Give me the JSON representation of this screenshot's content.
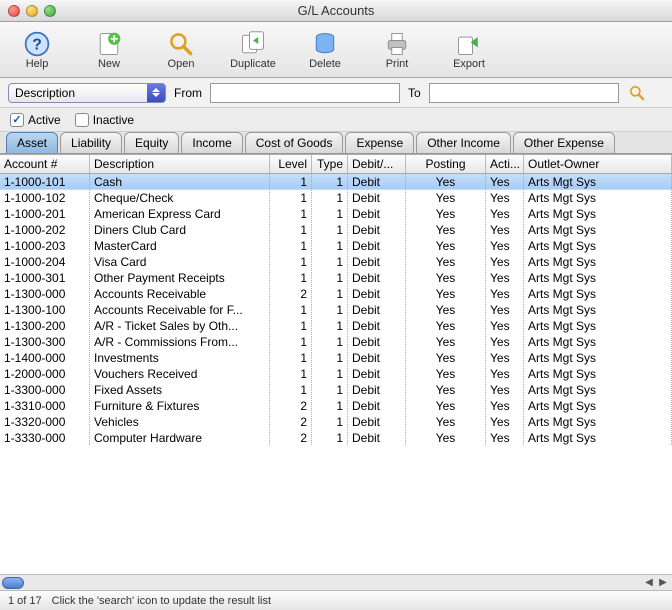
{
  "window": {
    "title": "G/L Accounts"
  },
  "toolbar": {
    "help": "Help",
    "new": "New",
    "open": "Open",
    "duplicate": "Duplicate",
    "delete": "Delete",
    "print": "Print",
    "export": "Export"
  },
  "search": {
    "field": "Description",
    "from_label": "From",
    "from_value": "",
    "to_label": "To",
    "to_value": ""
  },
  "filters": {
    "active_label": "Active",
    "active_checked": true,
    "inactive_label": "Inactive",
    "inactive_checked": false
  },
  "tabs": [
    {
      "label": "Asset",
      "active": true
    },
    {
      "label": "Liability",
      "active": false
    },
    {
      "label": "Equity",
      "active": false
    },
    {
      "label": "Income",
      "active": false
    },
    {
      "label": "Cost of Goods",
      "active": false
    },
    {
      "label": "Expense",
      "active": false
    },
    {
      "label": "Other Income",
      "active": false
    },
    {
      "label": "Other Expense",
      "active": false
    }
  ],
  "columns": [
    "Account #",
    "Description",
    "Level",
    "Type",
    "Debit/...",
    "Posting",
    "Acti...",
    "Outlet-Owner"
  ],
  "rows": [
    {
      "acct": "1-1000-101",
      "desc": "Cash",
      "level": "1",
      "type": "1",
      "dc": "Debit",
      "posting": "Yes",
      "active": "Yes",
      "owner": "Arts Mgt Sys",
      "selected": true
    },
    {
      "acct": "1-1000-102",
      "desc": "Cheque/Check",
      "level": "1",
      "type": "1",
      "dc": "Debit",
      "posting": "Yes",
      "active": "Yes",
      "owner": "Arts Mgt Sys"
    },
    {
      "acct": "1-1000-201",
      "desc": "American Express Card",
      "level": "1",
      "type": "1",
      "dc": "Debit",
      "posting": "Yes",
      "active": "Yes",
      "owner": "Arts Mgt Sys"
    },
    {
      "acct": "1-1000-202",
      "desc": "Diners Club Card",
      "level": "1",
      "type": "1",
      "dc": "Debit",
      "posting": "Yes",
      "active": "Yes",
      "owner": "Arts Mgt Sys"
    },
    {
      "acct": "1-1000-203",
      "desc": "MasterCard",
      "level": "1",
      "type": "1",
      "dc": "Debit",
      "posting": "Yes",
      "active": "Yes",
      "owner": "Arts Mgt Sys"
    },
    {
      "acct": "1-1000-204",
      "desc": "Visa Card",
      "level": "1",
      "type": "1",
      "dc": "Debit",
      "posting": "Yes",
      "active": "Yes",
      "owner": "Arts Mgt Sys"
    },
    {
      "acct": "1-1000-301",
      "desc": "Other Payment Receipts",
      "level": "1",
      "type": "1",
      "dc": "Debit",
      "posting": "Yes",
      "active": "Yes",
      "owner": "Arts Mgt Sys"
    },
    {
      "acct": "1-1300-000",
      "desc": "Accounts Receivable",
      "level": "2",
      "type": "1",
      "dc": "Debit",
      "posting": "Yes",
      "active": "Yes",
      "owner": "Arts Mgt Sys"
    },
    {
      "acct": "1-1300-100",
      "desc": "Accounts Receivable for F...",
      "level": "1",
      "type": "1",
      "dc": "Debit",
      "posting": "Yes",
      "active": "Yes",
      "owner": "Arts Mgt Sys"
    },
    {
      "acct": "1-1300-200",
      "desc": "A/R - Ticket Sales by Oth...",
      "level": "1",
      "type": "1",
      "dc": "Debit",
      "posting": "Yes",
      "active": "Yes",
      "owner": "Arts Mgt Sys"
    },
    {
      "acct": "1-1300-300",
      "desc": "A/R - Commissions From...",
      "level": "1",
      "type": "1",
      "dc": "Debit",
      "posting": "Yes",
      "active": "Yes",
      "owner": "Arts Mgt Sys"
    },
    {
      "acct": "1-1400-000",
      "desc": "Investments",
      "level": "1",
      "type": "1",
      "dc": "Debit",
      "posting": "Yes",
      "active": "Yes",
      "owner": "Arts Mgt Sys"
    },
    {
      "acct": "1-2000-000",
      "desc": "Vouchers Received",
      "level": "1",
      "type": "1",
      "dc": "Debit",
      "posting": "Yes",
      "active": "Yes",
      "owner": "Arts Mgt Sys"
    },
    {
      "acct": "1-3300-000",
      "desc": "Fixed Assets",
      "level": "1",
      "type": "1",
      "dc": "Debit",
      "posting": "Yes",
      "active": "Yes",
      "owner": "Arts Mgt Sys"
    },
    {
      "acct": "1-3310-000",
      "desc": "Furniture & Fixtures",
      "level": "2",
      "type": "1",
      "dc": "Debit",
      "posting": "Yes",
      "active": "Yes",
      "owner": "Arts Mgt Sys"
    },
    {
      "acct": "1-3320-000",
      "desc": "Vehicles",
      "level": "2",
      "type": "1",
      "dc": "Debit",
      "posting": "Yes",
      "active": "Yes",
      "owner": "Arts Mgt Sys"
    },
    {
      "acct": "1-3330-000",
      "desc": "Computer Hardware",
      "level": "2",
      "type": "1",
      "dc": "Debit",
      "posting": "Yes",
      "active": "Yes",
      "owner": "Arts Mgt Sys"
    }
  ],
  "status": {
    "count": "1 of 17",
    "hint": "Click the 'search' icon to update the result list"
  }
}
